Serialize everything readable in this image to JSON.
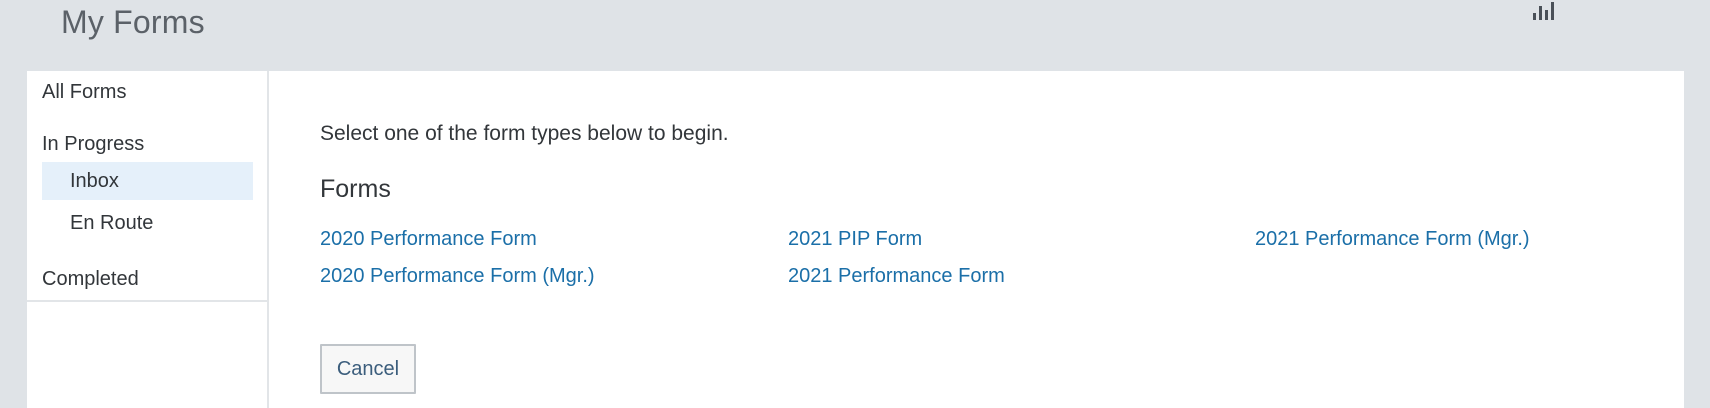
{
  "header": {
    "title": "My Forms",
    "chart_icon": "bar-chart-icon"
  },
  "sidebar": {
    "all_forms": "All Forms",
    "in_progress": "In Progress",
    "inbox": "Inbox",
    "en_route": "En Route",
    "completed": "Completed"
  },
  "main": {
    "intro": "Select one of the form types below to begin.",
    "section_title": "Forms",
    "forms": [
      "2020 Performance Form",
      "2021 PIP Form",
      "2021 Performance Form (Mgr.)",
      "2020 Performance Form (Mgr.)",
      "2021 Performance Form"
    ],
    "cancel_label": "Cancel"
  },
  "colors": {
    "background": "#dfe3e7",
    "link": "#1b6fa8",
    "selected": "#e5f0fa"
  }
}
